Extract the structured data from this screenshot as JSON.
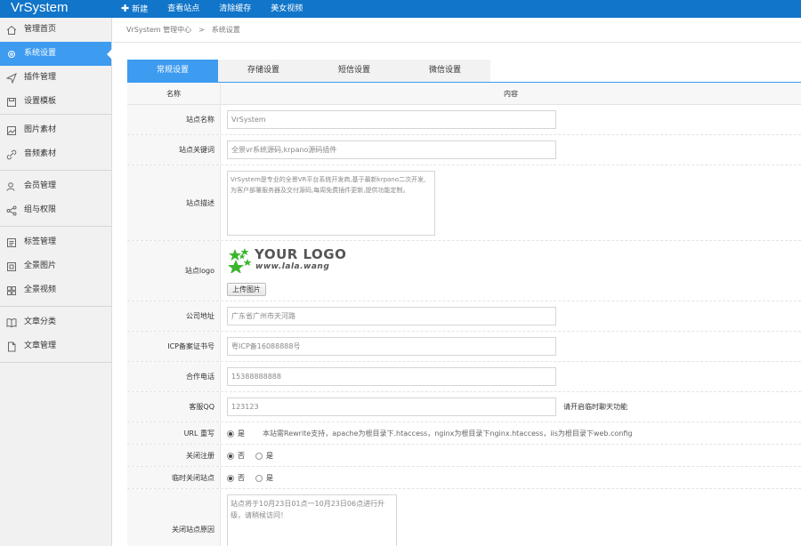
{
  "app": {
    "brand": "VrSystem"
  },
  "topnav": [
    {
      "label": "新建",
      "icon": "plus-icon"
    },
    {
      "label": "查看站点"
    },
    {
      "label": "清除缓存"
    },
    {
      "label": "美女视频"
    }
  ],
  "sidebar": {
    "items": [
      {
        "label": "管理首页",
        "icon": "home-icon"
      },
      {
        "label": "系统设置",
        "icon": "gear-icon",
        "active": true
      },
      {
        "label": "插件管理",
        "icon": "send-icon"
      },
      {
        "label": "设置模板",
        "icon": "save-icon"
      },
      {
        "label": "图片素材",
        "icon": "image-icon"
      },
      {
        "label": "音频素材",
        "icon": "link-icon"
      },
      {
        "label": "会员管理",
        "icon": "users-icon"
      },
      {
        "label": "组与权限",
        "icon": "share-icon"
      },
      {
        "label": "标签管理",
        "icon": "list-icon"
      },
      {
        "label": "全景图片",
        "icon": "panorama-icon"
      },
      {
        "label": "全景视频",
        "icon": "grid-icon"
      },
      {
        "label": "文章分类",
        "icon": "book-icon"
      },
      {
        "label": "文章管理",
        "icon": "document-icon"
      }
    ]
  },
  "breadcrumb": {
    "root": "VrSystem 管理中心",
    "sep": ">",
    "current": "系统设置"
  },
  "tabs": [
    {
      "label": "常规设置",
      "active": true
    },
    {
      "label": "存储设置"
    },
    {
      "label": "短信设置"
    },
    {
      "label": "微信设置"
    }
  ],
  "table": {
    "col_name": "名称",
    "col_value": "内容"
  },
  "form": {
    "site_name": {
      "label": "站点名称",
      "value": "VrSystem"
    },
    "keywords": {
      "label": "站点关键词",
      "value": "全景vr系统源码,krpano源码插件"
    },
    "description": {
      "label": "站点描述",
      "value": "VrSystem是专业的全景VR平台系统开发商,基于最新krpano二次开发,为客户部署服务器及交付源码,每周免费插件更新,提供功能定制。"
    },
    "logo": {
      "label": "站点logo",
      "logo_title": "YOUR LOGO",
      "logo_url": "www.lala.wang",
      "upload_label": "上传图片"
    },
    "address": {
      "label": "公司地址",
      "value": "广东省广州市天河路"
    },
    "icp": {
      "label": "ICP备案证书号",
      "value": "粤ICP备16088888号"
    },
    "phone": {
      "label": "合作电话",
      "value": "15388888888"
    },
    "qq": {
      "label": "客服QQ",
      "value": "123123",
      "hint": "请开启临时聊天功能"
    },
    "rewrite": {
      "label": "URL 重写",
      "option_yes": "是",
      "note": "本站需Rewrite支持，apache为根目录下.htaccess，nginx为根目录下nginx.htaccess，iis为根目录下web.config"
    },
    "close_register": {
      "label": "关闭注册",
      "option_no": "否",
      "option_yes": "是"
    },
    "close_site": {
      "label": "临时关闭站点",
      "option_no": "否",
      "option_yes": "是"
    },
    "close_reason": {
      "label": "关闭站点原因",
      "value": "站点将于10月23日01点一10月23日06点进行升级，请稍候访问！"
    }
  },
  "colors": {
    "topbar": "#1175c9",
    "accent": "#3d9bf0",
    "logo_green": "#3cb52e"
  }
}
